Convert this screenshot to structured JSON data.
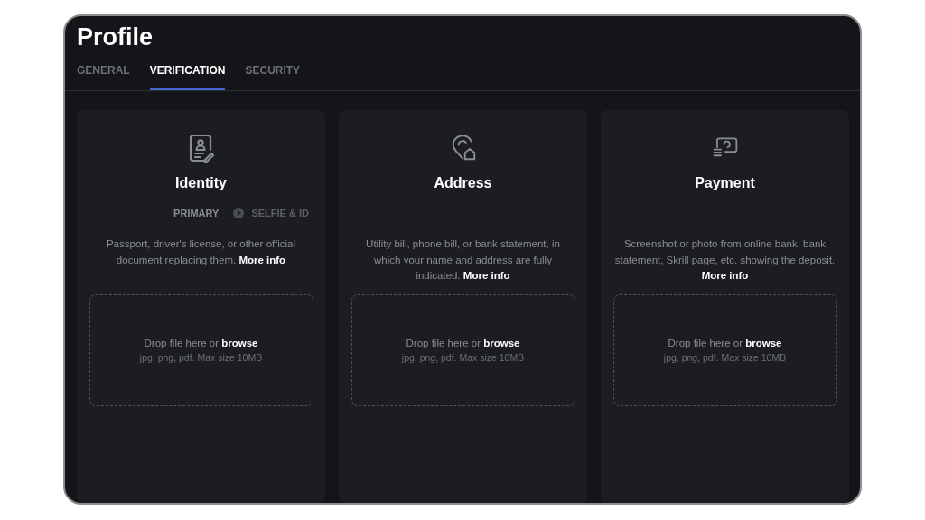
{
  "title": "Profile",
  "tabs": [
    {
      "label": "GENERAL",
      "selected": false
    },
    {
      "label": "VERIFICATION",
      "selected": true
    },
    {
      "label": "SECURITY",
      "selected": false
    }
  ],
  "cards": [
    {
      "title": "Identity",
      "steps": [
        {
          "label": "PRIMARY",
          "selected": true
        },
        {
          "label": "SELFIE & ID",
          "selected": false
        }
      ],
      "description": "Passport, driver's license, or other official document replacing them.",
      "link": "More info",
      "drop": {
        "text": "Drop file here or",
        "link": "browse",
        "hint": "jpg, png, pdf. Max size 10MB"
      }
    },
    {
      "title": "Address",
      "description": "Utility bill, phone bill, or bank statement, in which your name and address are fully indicated.",
      "link": "More info",
      "drop": {
        "text": "Drop file here or",
        "link": "browse",
        "hint": "jpg, png, pdf. Max size 10MB"
      }
    },
    {
      "title": "Payment",
      "description": "Screenshot or photo from online bank, bank statement, Skrill page, etc. showing the deposit.",
      "link": "More info",
      "drop": {
        "text": "Drop file here or",
        "link": "browse",
        "hint": "jpg, png, pdf. Max size 10MB"
      }
    }
  ]
}
